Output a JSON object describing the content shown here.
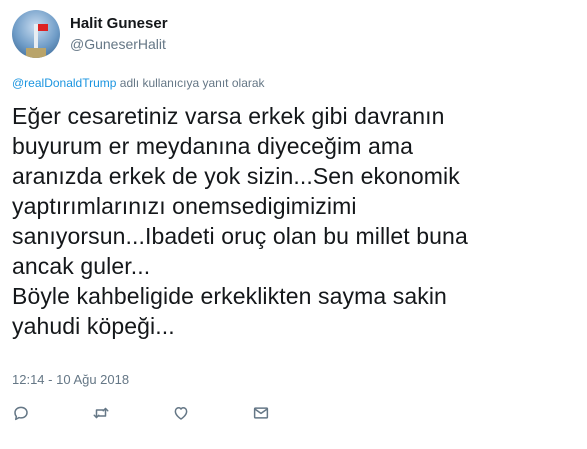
{
  "user": {
    "display_name": "Halit Guneser",
    "handle": "@GuneserHalit"
  },
  "reply_context": {
    "mention": "@realDonaldTrump",
    "suffix": " adlı kullanıcıya yanıt olarak"
  },
  "tweet": {
    "text": "Eğer cesaretiniz varsa erkek gibi davranın\nbuyurum er meydanına diyeceğim ama\naranızda erkek de yok sizin...Sen ekonomik\nyaptırımlarınızı  onemsedigimizimi\nsanıyorsun...Ibadeti  oruç olan bu millet buna\nancak guler...\nBöyle kahbeligide erkeklikten sayma sakin\nyahudi köpeği...",
    "timestamp": "12:14 - 10 Ağu 2018"
  },
  "actions": [
    {
      "icon": "reply-icon"
    },
    {
      "icon": "retweet-icon"
    },
    {
      "icon": "like-icon"
    },
    {
      "icon": "direct-message-icon"
    }
  ],
  "colors": {
    "text": "#14171a",
    "secondary": "#657786",
    "link": "#1b95e0",
    "icon": "#657786"
  }
}
